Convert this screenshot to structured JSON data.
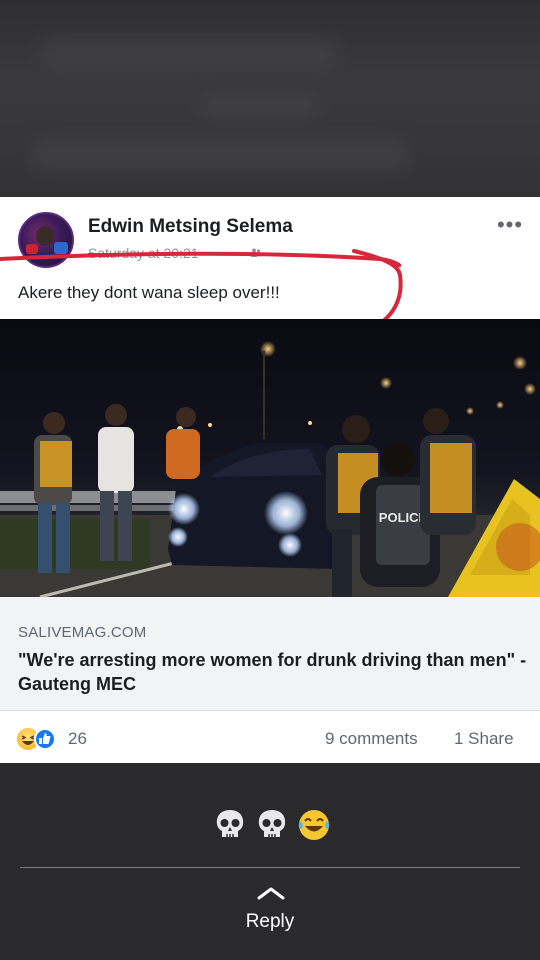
{
  "post": {
    "author_name": "Edwin Metsing Selema",
    "timestamp": "Saturday at 20:21",
    "privacy_icon": "friends-icon",
    "more_icon": "more-dots-icon",
    "text": "Akere they dont wana sleep over!!!",
    "annotation_color": "#d6283a"
  },
  "link": {
    "image_sign_text": "POLICE",
    "domain": "SALIVEMAG.COM",
    "title": "\"We're arresting more women for drunk driving than men\" - Gauteng MEC"
  },
  "engagement": {
    "reaction_icons": [
      "haha-icon",
      "like-icon"
    ],
    "reaction_count": "26",
    "comments": "9 comments",
    "shares": "1 Share"
  },
  "reply_area": {
    "emojis": [
      "skull-icon",
      "skull-icon",
      "tears-of-joy-icon"
    ],
    "reply_label": "Reply"
  },
  "colors": {
    "background": "#2b2b2d",
    "card": "#ffffff",
    "link_preview_bg": "#f2f3f5",
    "facebook_blue": "#1877f2"
  }
}
